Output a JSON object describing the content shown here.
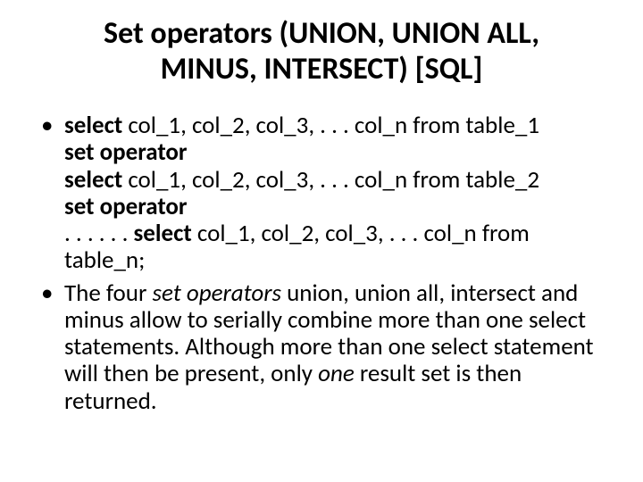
{
  "title_line1": "Set operators (UNION, UNION ALL,",
  "title_line2": "MINUS, INTERSECT) [SQL]",
  "b1": {
    "select1_kw": "select ",
    "select1_rest": "col_1, col_2, col_3, . . . col_n from table_1",
    "setop1": "set operator",
    "select2_kw": "select ",
    "select2_rest": "col_1, col_2, col_3, . . . col_n from table_2",
    "setop2": "set operator",
    "dots": ". . . . . . ",
    "select3_kw": "select ",
    "select3_rest": "col_1, col_2, col_3, . . . col_n from table_n;"
  },
  "b2": {
    "p1": "The four ",
    "p2": "set operators ",
    "p3": "union, union all, intersect and minus allow to serially combine more than one select statements. Although more than one select statement will then be present, only ",
    "p4": "one",
    "p5": " result set is then returned."
  }
}
